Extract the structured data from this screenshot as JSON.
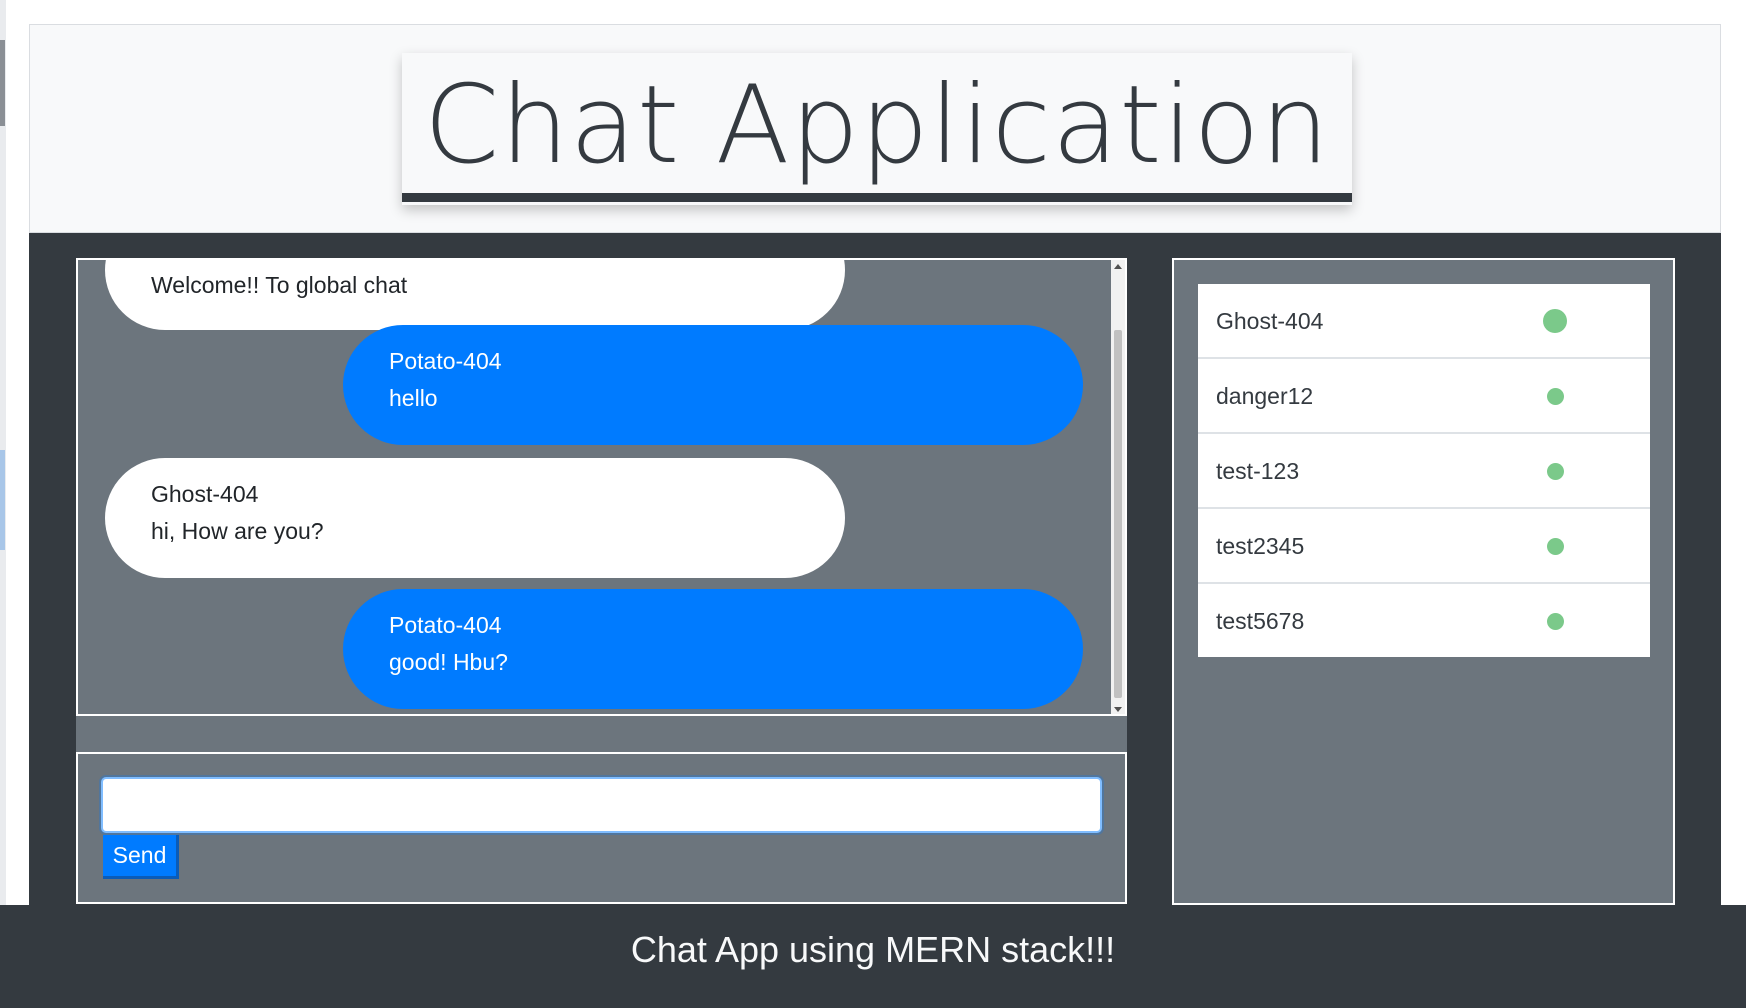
{
  "header": {
    "title": "Chat Application"
  },
  "chat": {
    "messages": [
      {
        "direction": "incoming",
        "sender": "",
        "text": "Welcome!! To global chat"
      },
      {
        "direction": "outgoing",
        "sender": "Potato-404",
        "text": "hello"
      },
      {
        "direction": "incoming",
        "sender": "Ghost-404",
        "text": "hi, How are you?"
      },
      {
        "direction": "outgoing",
        "sender": "Potato-404",
        "text": "good! Hbu?"
      }
    ]
  },
  "composer": {
    "input_value": "",
    "send_label": "Send"
  },
  "users": {
    "items": [
      {
        "name": "Ghost-404",
        "status": "online"
      },
      {
        "name": "danger12",
        "status": "online"
      },
      {
        "name": "test-123",
        "status": "online"
      },
      {
        "name": "test2345",
        "status": "online"
      },
      {
        "name": "test5678",
        "status": "online"
      }
    ]
  },
  "footer": {
    "text": "Chat App using MERN stack!!!"
  },
  "colors": {
    "dark": "#343a40",
    "panel": "#6c757d",
    "primary": "#007bff",
    "online": "#7bc98a"
  }
}
